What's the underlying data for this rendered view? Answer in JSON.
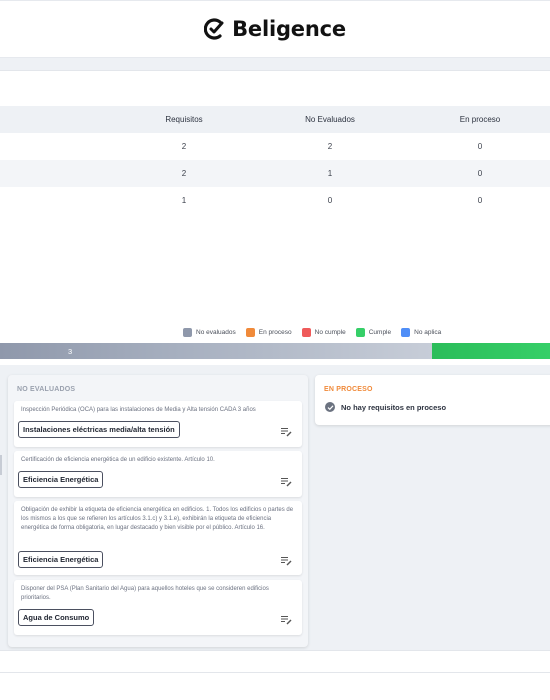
{
  "header": {
    "brand": "Beligence"
  },
  "table": {
    "columns": [
      "Requisitos",
      "No Evaluados",
      "En proceso"
    ],
    "rows": [
      [
        "2",
        "2",
        "0"
      ],
      [
        "2",
        "1",
        "0"
      ],
      [
        "1",
        "0",
        "0"
      ]
    ]
  },
  "legend": [
    {
      "label": "No evaluados",
      "color": "#8f98ab"
    },
    {
      "label": "En proceso",
      "color": "#f08a3a"
    },
    {
      "label": "No cumple",
      "color": "#ef5a5a"
    },
    {
      "label": "Cumple",
      "color": "#36cf68"
    },
    {
      "label": "No aplica",
      "color": "#4f8ef7"
    }
  ],
  "progress": {
    "no_evaluados_label": "3",
    "no_evaluados_fraction": 0.785,
    "cumple_fraction": 0.215
  },
  "columns": {
    "no_evaluados": {
      "title": "NO EVALUADOS",
      "cards": [
        {
          "text": "Inspección Periódica (OCA) para las instalaciones de Media y Alta tensión CADA 3 años",
          "tag": "Instalaciones eléctricas media/alta tensión"
        },
        {
          "text": "Certificación de eficiencia energética de un edificio existente. Artículo 10.",
          "tag": "Eficiencia Energética"
        },
        {
          "text": "Obligación de exhibir la etiqueta de eficiencia energética en edificios. 1. Todos los edificios o partes de los mismos a los que se refieren los artículos 3.1.c) y 3.1.e), exhibirán la etiqueta de eficiencia energética de forma obligatoria, en lugar destacado y bien visible por el público. Artículo 16.",
          "tag": "Eficiencia Energética"
        },
        {
          "text": "Disponer del PSA (Plan Sanitario del Agua) para aquellos hoteles que se consideren edificios prioritarios.",
          "tag": "Agua de Consumo"
        }
      ]
    },
    "en_proceso": {
      "title": "EN PROCESO",
      "empty_text": "No hay requisitos en proceso"
    }
  }
}
